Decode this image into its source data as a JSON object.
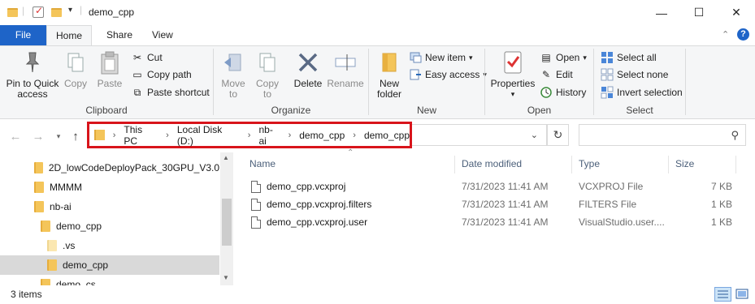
{
  "window": {
    "title": "demo_cpp",
    "minimize_glyph": "—",
    "maximize_glyph": "☐",
    "close_glyph": "✕"
  },
  "tabs": {
    "file": "File",
    "home": "Home",
    "share": "Share",
    "view": "View"
  },
  "ribbon": {
    "clipboard": {
      "pin": "Pin to Quick access",
      "copy": "Copy",
      "paste": "Paste",
      "cut": "Cut",
      "copy_path": "Copy path",
      "paste_shortcut": "Paste shortcut",
      "label": "Clipboard"
    },
    "organize": {
      "move_to": "Move to",
      "copy_to": "Copy to",
      "delete": "Delete",
      "rename": "Rename",
      "label": "Organize"
    },
    "new": {
      "new_folder": "New folder",
      "new_item": "New item",
      "easy_access": "Easy access",
      "label": "New"
    },
    "open": {
      "properties": "Properties",
      "open": "Open",
      "edit": "Edit",
      "history": "History",
      "label": "Open"
    },
    "select": {
      "select_all": "Select all",
      "select_none": "Select none",
      "invert_selection": "Invert selection",
      "label": "Select"
    }
  },
  "address": {
    "crumbs": [
      "This PC",
      "Local Disk (D:)",
      "nb-ai",
      "demo_cpp",
      "demo_cpp"
    ],
    "highlight_color": "#d8141b"
  },
  "tree": [
    {
      "label": "2D_lowCodeDeployPack_30GPU_V3.0"
    },
    {
      "label": "MMMM"
    },
    {
      "label": "nb-ai"
    },
    {
      "label": "demo_cpp"
    },
    {
      "label": ".vs"
    },
    {
      "label": "demo_cpp"
    },
    {
      "label": "demo_cs"
    }
  ],
  "columns": {
    "name": "Name",
    "date": "Date modified",
    "type": "Type",
    "size": "Size"
  },
  "files": [
    {
      "name": "demo_cpp.vcxproj",
      "date": "7/31/2023 11:41 AM",
      "type": "VCXPROJ File",
      "size": "7 KB"
    },
    {
      "name": "demo_cpp.vcxproj.filters",
      "date": "7/31/2023 11:41 AM",
      "type": "FILTERS File",
      "size": "1 KB"
    },
    {
      "name": "demo_cpp.vcxproj.user",
      "date": "7/31/2023 11:41 AM",
      "type": "VisualStudio.user....",
      "size": "1 KB"
    }
  ],
  "status": {
    "item_count": "3 items"
  }
}
